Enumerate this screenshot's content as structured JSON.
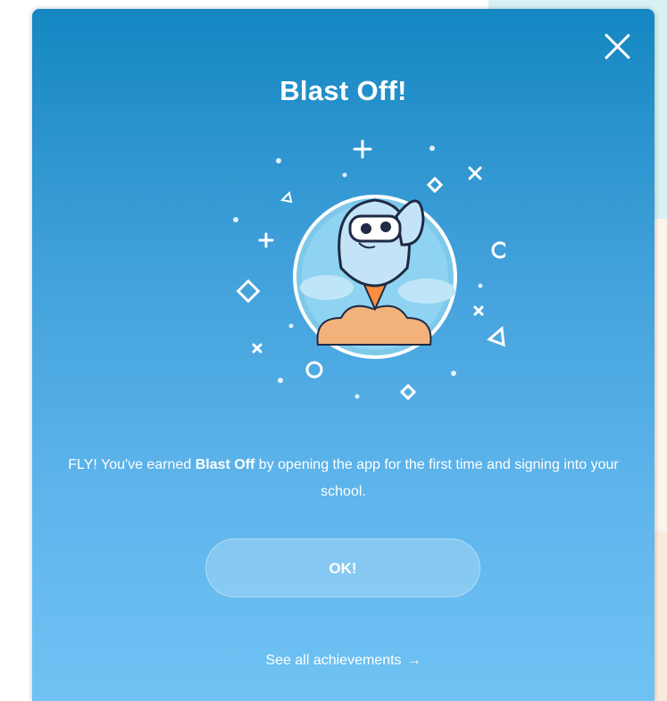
{
  "modal": {
    "title": "Blast Off!",
    "close_icon": "close-icon",
    "illustration": "owl-rocket-badge-icon",
    "message_prefix": "FLY! You've earned ",
    "message_bold": "Blast Off",
    "message_suffix": " by opening the app for the first time and signing into your school.",
    "ok_label": "OK!",
    "see_all_label": "See all achievements",
    "see_all_arrow": "→"
  },
  "colors": {
    "modal_top": "#1487c2",
    "modal_bottom": "#70c2f3",
    "text": "#ffffff",
    "background_strip_top": "#d7f1f4",
    "background_strip_bottom": "#fbe9dc"
  }
}
